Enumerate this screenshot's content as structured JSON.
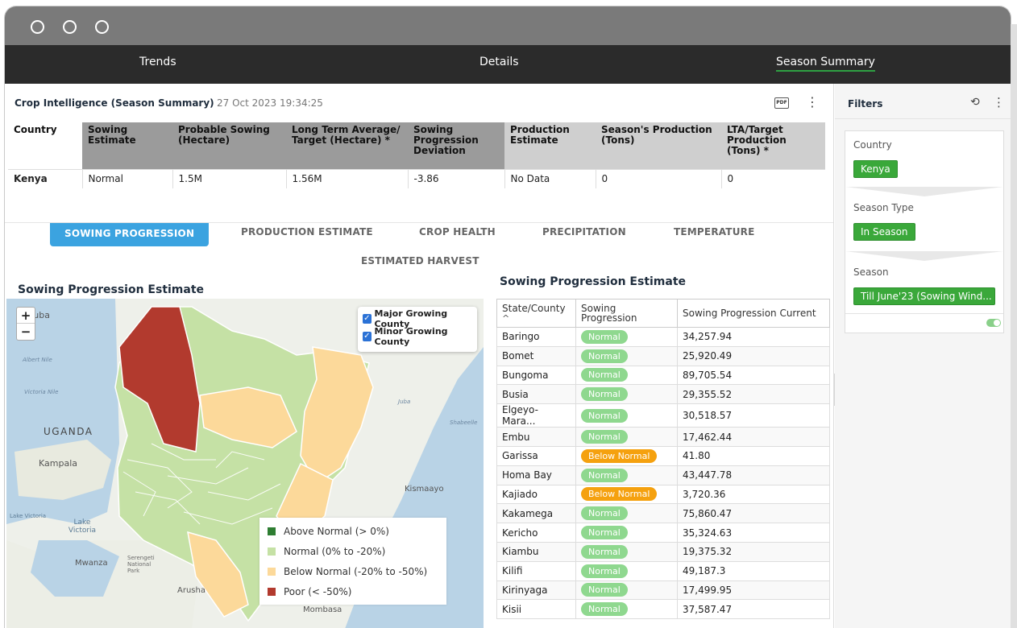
{
  "nav": {
    "tabs": [
      "Trends",
      "Details",
      "Season Summary"
    ],
    "active": "Season Summary"
  },
  "header": {
    "title": "Crop Intelligence (Season Summary)",
    "timestamp": "27 Oct 2023 19:34:25",
    "pdf_label": "PDF"
  },
  "summary_table": {
    "headers": [
      "Country",
      "Sowing Estimate",
      "Probable Sowing (Hectare)",
      "Long Term Average/ Target (Hectare) *",
      "Sowing Progression Deviation",
      "Production Estimate",
      "Season's Production (Tons)",
      "LTA/Target Production (Tons) *"
    ],
    "row": [
      "Kenya",
      "Normal",
      "1.5M",
      "1.56M",
      "-3.86",
      "No Data",
      "0",
      "0"
    ]
  },
  "main_tabs": [
    "SOWING PROGRESSION",
    "PRODUCTION ESTIMATE",
    "CROP HEALTH",
    "PRECIPITATION",
    "TEMPERATURE",
    "ESTIMATED HARVEST"
  ],
  "map": {
    "title": "Sowing Progression Estimate",
    "zoom_in": "+",
    "zoom_out": "−",
    "layers": [
      "Major Growing County",
      "Minor Growing County"
    ],
    "labels": [
      "Juba",
      "UGANDA",
      "Kampala",
      "Lake Victoria",
      "Mwanza",
      "Serengeti National Park",
      "Arusha",
      "Kismaayo",
      "Mombasa",
      "Victoria Nile",
      "Juba",
      "Shabeelle",
      "Lake Victoria",
      "Albert Nile"
    ],
    "legend": [
      {
        "label": "Above Normal (> 0%)",
        "color": "#2e7d32"
      },
      {
        "label": "Normal (0% to -20%)",
        "color": "#c5e1a5"
      },
      {
        "label": "Below Normal (-20% to -50%)",
        "color": "#fcd99a"
      },
      {
        "label": "Poor (< -50%)",
        "color": "#b23a2e"
      }
    ]
  },
  "county_table": {
    "title": "Sowing Progression Estimate",
    "headers": [
      "State/County",
      "Sowing Progression",
      "Sowing Progression Current"
    ],
    "sort_icon": "^",
    "rows": [
      {
        "county": "Baringo",
        "status": "Normal",
        "value": "34,257.94"
      },
      {
        "county": "Bomet",
        "status": "Normal",
        "value": "25,920.49"
      },
      {
        "county": "Bungoma",
        "status": "Normal",
        "value": "89,705.54"
      },
      {
        "county": "Busia",
        "status": "Normal",
        "value": "29,355.52"
      },
      {
        "county": "Elgeyo-Mara...",
        "status": "Normal",
        "value": "30,518.57"
      },
      {
        "county": "Embu",
        "status": "Normal",
        "value": "17,462.44"
      },
      {
        "county": "Garissa",
        "status": "Below Normal",
        "value": "41.80"
      },
      {
        "county": "Homa Bay",
        "status": "Normal",
        "value": "43,447.78"
      },
      {
        "county": "Kajiado",
        "status": "Below Normal",
        "value": "3,720.36"
      },
      {
        "county": "Kakamega",
        "status": "Normal",
        "value": "75,860.47"
      },
      {
        "county": "Kericho",
        "status": "Normal",
        "value": "35,324.63"
      },
      {
        "county": "Kiambu",
        "status": "Normal",
        "value": "19,375.32"
      },
      {
        "county": "Kilifi",
        "status": "Normal",
        "value": "49,187.3"
      },
      {
        "county": "Kirinyaga",
        "status": "Normal",
        "value": "17,499.95"
      },
      {
        "county": "Kisii",
        "status": "Normal",
        "value": "37,587.47"
      }
    ],
    "status_colors": {
      "Normal": "#8fd88f",
      "Below Normal": "#f5a10f"
    }
  },
  "filters": {
    "title": "Filters",
    "sections": [
      {
        "label": "Country",
        "value": "Kenya"
      },
      {
        "label": "Season Type",
        "value": "In Season"
      },
      {
        "label": "Season",
        "value": "Till June'23 (Sowing Wind..."
      }
    ]
  }
}
